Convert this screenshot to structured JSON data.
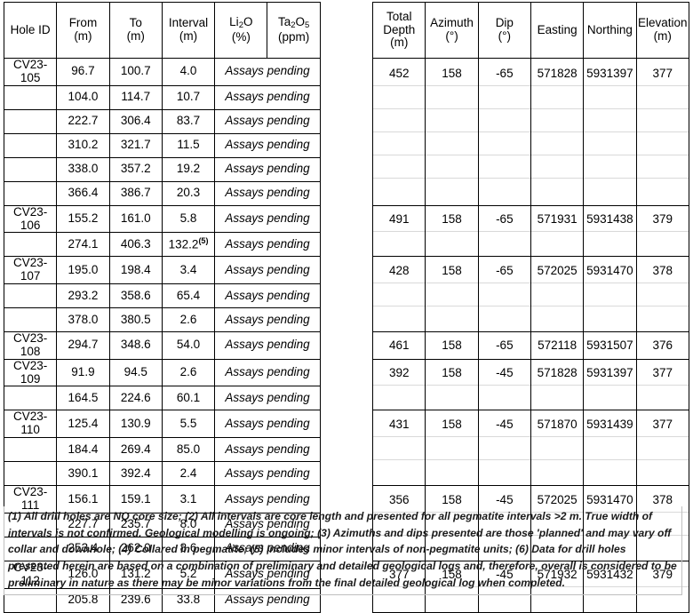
{
  "table": {
    "headers": {
      "hole_id": "Hole ID",
      "from": "From",
      "from_unit": "(m)",
      "to": "To",
      "to_unit": "(m)",
      "interval": "Interval",
      "interval_unit": "(m)",
      "li2o_prefix": "Li",
      "li2o_sub": "2",
      "li2o_suffix": "O",
      "li2o_unit": "(%)",
      "ta2o5_prefix": "Ta",
      "ta2o5_sub1": "2",
      "ta2o5_mid": "O",
      "ta2o5_sub2": "5",
      "ta2o5_unit": "(ppm)",
      "total_depth_l1": "Total",
      "total_depth_l2": "Depth",
      "total_depth_unit": "(m)",
      "azimuth": "Azimuth",
      "azimuth_unit": "(°)",
      "dip": "Dip",
      "dip_unit": "(°)",
      "easting": "Easting",
      "northing": "Northing",
      "elevation": "Elevation",
      "elevation_unit": "(m)"
    },
    "assay_pending_label": "Assays pending",
    "holes": [
      {
        "hole_id": "CV23-105",
        "total_depth": "452",
        "azimuth": "158",
        "dip": "-65",
        "easting": "571828",
        "northing": "5931397",
        "elevation": "377",
        "intervals": [
          {
            "from": "96.7",
            "to": "100.7",
            "interval": "4.0",
            "bold": false,
            "note": ""
          },
          {
            "from": "104.0",
            "to": "114.7",
            "interval": "10.7",
            "bold": false,
            "note": ""
          },
          {
            "from": "222.7",
            "to": "306.4",
            "interval": "83.7",
            "bold": true,
            "note": ""
          },
          {
            "from": "310.2",
            "to": "321.7",
            "interval": "11.5",
            "bold": false,
            "note": ""
          },
          {
            "from": "338.0",
            "to": "357.2",
            "interval": "19.2",
            "bold": true,
            "note": ""
          },
          {
            "from": "366.4",
            "to": "386.7",
            "interval": "20.3",
            "bold": true,
            "note": ""
          }
        ]
      },
      {
        "hole_id": "CV23-106",
        "total_depth": "491",
        "azimuth": "158",
        "dip": "-65",
        "easting": "571931",
        "northing": "5931438",
        "elevation": "379",
        "intervals": [
          {
            "from": "155.2",
            "to": "161.0",
            "interval": "5.8",
            "bold": false,
            "note": ""
          },
          {
            "from": "274.1",
            "to": "406.3",
            "interval": "132.2",
            "bold": true,
            "note": "(5)"
          }
        ]
      },
      {
        "hole_id": "CV23-107",
        "total_depth": "428",
        "azimuth": "158",
        "dip": "-65",
        "easting": "572025",
        "northing": "5931470",
        "elevation": "378",
        "intervals": [
          {
            "from": "195.0",
            "to": "198.4",
            "interval": "3.4",
            "bold": false,
            "note": ""
          },
          {
            "from": "293.2",
            "to": "358.6",
            "interval": "65.4",
            "bold": true,
            "note": ""
          },
          {
            "from": "378.0",
            "to": "380.5",
            "interval": "2.6",
            "bold": false,
            "note": ""
          }
        ]
      },
      {
        "hole_id": "CV23-108",
        "total_depth": "461",
        "azimuth": "158",
        "dip": "-65",
        "easting": "572118",
        "northing": "5931507",
        "elevation": "376",
        "intervals": [
          {
            "from": "294.7",
            "to": "348.6",
            "interval": "54.0",
            "bold": true,
            "note": ""
          }
        ]
      },
      {
        "hole_id": "CV23-109",
        "total_depth": "392",
        "azimuth": "158",
        "dip": "-45",
        "easting": "571828",
        "northing": "5931397",
        "elevation": "377",
        "intervals": [
          {
            "from": "91.9",
            "to": "94.5",
            "interval": "2.6",
            "bold": false,
            "note": ""
          },
          {
            "from": "164.5",
            "to": "224.6",
            "interval": "60.1",
            "bold": true,
            "note": ""
          }
        ]
      },
      {
        "hole_id": "CV23-110",
        "total_depth": "431",
        "azimuth": "158",
        "dip": "-45",
        "easting": "571870",
        "northing": "5931439",
        "elevation": "377",
        "intervals": [
          {
            "from": "125.4",
            "to": "130.9",
            "interval": "5.5",
            "bold": false,
            "note": ""
          },
          {
            "from": "184.4",
            "to": "269.4",
            "interval": "85.0",
            "bold": true,
            "note": ""
          },
          {
            "from": "390.1",
            "to": "392.4",
            "interval": "2.4",
            "bold": false,
            "note": ""
          }
        ]
      },
      {
        "hole_id": "CV23-111",
        "total_depth": "356",
        "azimuth": "158",
        "dip": "-45",
        "easting": "572025",
        "northing": "5931470",
        "elevation": "378",
        "intervals": [
          {
            "from": "156.1",
            "to": "159.1",
            "interval": "3.1",
            "bold": false,
            "note": ""
          },
          {
            "from": "227.7",
            "to": "235.7",
            "interval": "8.0",
            "bold": false,
            "note": ""
          },
          {
            "from": "253.4",
            "to": "262.0",
            "interval": "8.6",
            "bold": false,
            "note": ""
          }
        ]
      },
      {
        "hole_id": "CV23-112",
        "total_depth": "377",
        "azimuth": "158",
        "dip": "-45",
        "easting": "571932",
        "northing": "5931432",
        "elevation": "379",
        "intervals": [
          {
            "from": "126.0",
            "to": "131.2",
            "interval": "5.2",
            "bold": false,
            "note": ""
          },
          {
            "from": "205.8",
            "to": "239.6",
            "interval": "33.8",
            "bold": true,
            "note": ""
          }
        ]
      }
    ]
  },
  "footnote": {
    "text": "(1) All drill holes are NQ core size; (2) All intervals are core length and presented for all pegmatite intervals >2 m. True width of intervals is not confirmed. Geological modelling is ongoing; (3) Azimuths and dips presented are those 'planned' and may vary off collar and downhole; (4) Collared in pegmatite; (5) Includes minor intervals of non-pegmatite units; (6) Data for drill holes presented herein are based on a combination of preliminary and detailed geological logs and, therefore, overall is considered to be preliminary in nature as there may be minor variations from the final detailed geological log when completed."
  }
}
